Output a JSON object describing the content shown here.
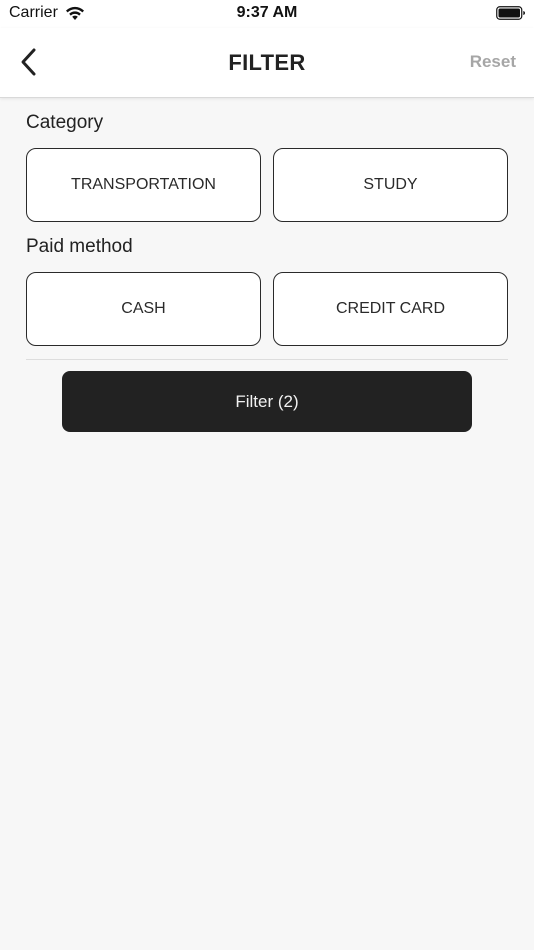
{
  "status_bar": {
    "carrier": "Carrier",
    "time": "9:37 AM",
    "icons": [
      "wifi-icon",
      "battery-icon"
    ]
  },
  "nav": {
    "back_icon": "chevron-left-icon",
    "title": "FILTER",
    "reset_label": "Reset"
  },
  "category": {
    "label": "Category",
    "options": [
      "TRANSPORTATION",
      "STUDY"
    ]
  },
  "paid_method": {
    "label": "Paid method",
    "options": [
      "CASH",
      "CREDIT CARD"
    ]
  },
  "filter_button": {
    "label": "Filter (2)"
  },
  "colors": {
    "background": "#f7f7f7",
    "primary": "#222222",
    "reset_text": "#a6a6a6",
    "option_border": "#2a2a2a"
  }
}
